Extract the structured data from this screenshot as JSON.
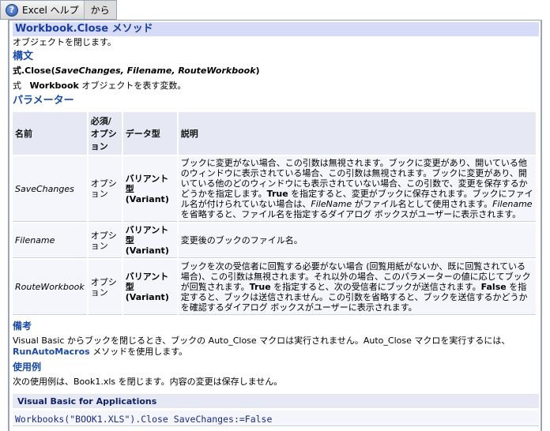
{
  "tabs": {
    "help_label": "Excel ヘルプ",
    "from_label": "から",
    "help_icon": "question-icon"
  },
  "title": "Workbook.Close メソッド",
  "summary": "オブジェクトを閉じます。",
  "syntax": {
    "heading": "構文",
    "prefix": "式.Close(",
    "args": "SaveChanges, Filename, RouteWorkbook",
    "suffix": ")",
    "expr": "式",
    "expr_obj": "Workbook",
    "expr_desc": " オブジェクトを表す変数。"
  },
  "params": {
    "heading": "パラメーター",
    "headers": [
      "名前",
      "必須/オプション",
      "データ型",
      "説明"
    ],
    "rows": [
      {
        "name": "SaveChanges",
        "req": "オプション",
        "type": "バリアント型 (Variant)",
        "desc": [
          [
            "ブックに変更がない場合、この引数は無視されます。ブックに変更があり、開いている他のウィンドウに表示されている場合、この引数は無視されます。ブックに変更があり、開いている他のどのウィンドウにも表示されていない場合、この引数で、変更を保存するかどうかを指定します。",
            ""
          ],
          [
            "True",
            "b"
          ],
          [
            " を指定すると、変更がブックに保存されます。ブックにファイル名が付けられていない場合は、",
            ""
          ],
          [
            "FileName",
            "it"
          ],
          [
            " がファイル名として使用されます。",
            ""
          ],
          [
            "Filename",
            "it"
          ],
          [
            " を省略すると、ファイル名を指定するダイアログ ボックスがユーザーに表示されます。",
            ""
          ]
        ]
      },
      {
        "name": "Filename",
        "req": "オプション",
        "type": "バリアント型 (Variant)",
        "desc": [
          [
            "変更後のブックのファイル名。",
            ""
          ]
        ]
      },
      {
        "name": "RouteWorkbook",
        "req": "オプション",
        "type": "バリアント型 (Variant)",
        "desc": [
          [
            "ブックを次の受信者に回覧する必要がない場合 (回覧用紙がないか、既に回覧されている場合)、この引数は無視されます。それ以外の場合、このパラメーターの値に応じてブックが回覧されます。",
            ""
          ],
          [
            "True",
            "b"
          ],
          [
            " を指定すると、次の受信者にブックが送信されます。",
            ""
          ],
          [
            "False",
            "b"
          ],
          [
            " を指定すると、ブックは送信されません。この引数を省略すると、ブックを送信するかどうかを確認するダイアログ ボックスがユーザーに表示されます。",
            ""
          ]
        ]
      }
    ]
  },
  "remarks": {
    "heading": "備考",
    "text": "Visual Basic からブックを閉じるとき、ブックの Auto_Close マクロは実行されません。Auto_Close マクロを実行するには、",
    "link": "RunAutoMacros",
    "text2": " メソッドを使用します。"
  },
  "example": {
    "heading": "使用例",
    "text": "次の使用例は、Book1.xls を閉じます。内容の変更は保存しません。",
    "code_label": "Visual Basic for Applications",
    "code": "Workbooks(\"BOOK1.XLS\").Close SaveChanges:=False"
  }
}
